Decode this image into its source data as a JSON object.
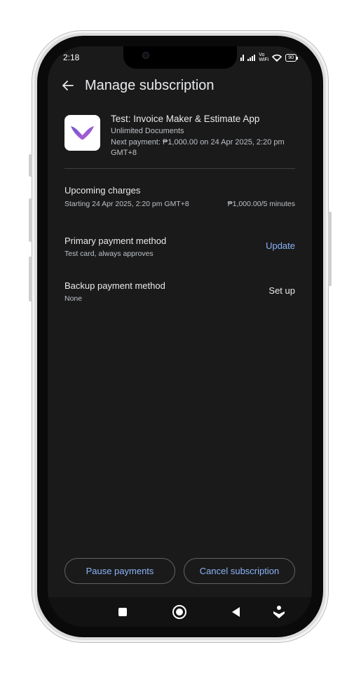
{
  "status_bar": {
    "time": "2:18",
    "network_label_top": "Vo",
    "network_label_bottom": "WiFi",
    "battery": "90"
  },
  "header": {
    "title": "Manage subscription",
    "back_icon": "arrow-back-icon"
  },
  "subscription": {
    "app_name": "Test: Invoice Maker & Estimate App",
    "plan": "Unlimited Documents",
    "next_payment": "Next payment: ₱1,000.00 on 24 Apr 2025, 2:20 pm GMT+8",
    "app_icon": "invoice-maker-logo",
    "accent_colors": [
      "#6a5acd",
      "#b44fd0"
    ]
  },
  "upcoming_charges": {
    "title": "Upcoming charges",
    "starting": "Starting 24 Apr 2025, 2:20 pm GMT+8",
    "amount": "₱1,000.00/5 minutes"
  },
  "primary_payment": {
    "title": "Primary payment method",
    "detail": "Test card, always approves",
    "action": "Update"
  },
  "backup_payment": {
    "title": "Backup payment method",
    "detail": "None",
    "action": "Set up"
  },
  "actions": {
    "pause": "Pause payments",
    "cancel": "Cancel subscription"
  },
  "colors": {
    "background": "#1a1a1a",
    "link": "#8ab4f8",
    "text_primary": "#e8eaed",
    "text_secondary": "#bdc1c6"
  }
}
